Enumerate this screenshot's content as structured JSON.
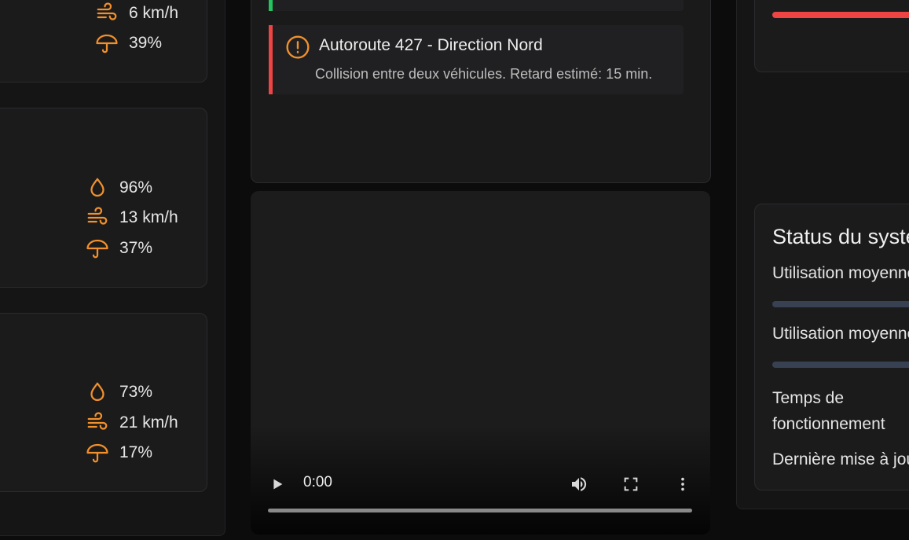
{
  "weather_cards": [
    {
      "humidity": "",
      "wind": "6 km/h",
      "rain": "39%"
    },
    {
      "humidity": "96%",
      "wind": "13 km/h",
      "rain": "37%"
    },
    {
      "humidity": "73%",
      "wind": "21 km/h",
      "rain": "17%"
    }
  ],
  "traffic": {
    "alert": {
      "title": "Autoroute 427 - Direction Nord",
      "description": "Collision entre deux véhicules. Retard estimé: 15 min.",
      "severity_color": "#ef4444"
    },
    "previous_alert_color": "#22c55e"
  },
  "video": {
    "time": "0:00",
    "progress": 0
  },
  "status": {
    "title": "Status du système",
    "cpu_label": "Utilisation moyenne",
    "memory_label": "Utilisation moyenne",
    "uptime_label_line1": "Temps de",
    "uptime_label_line2": "fonctionnement",
    "last_update_label": "Dernière mise à jour"
  },
  "colors": {
    "accent": "#f2902b",
    "alert_red": "#ef4444",
    "ok_green": "#22c55e",
    "bar_track": "#384151"
  },
  "icons": {
    "humidity": "droplet-icon",
    "wind": "wind-icon",
    "rain": "umbrella-icon",
    "alert": "alert-circle-icon"
  }
}
